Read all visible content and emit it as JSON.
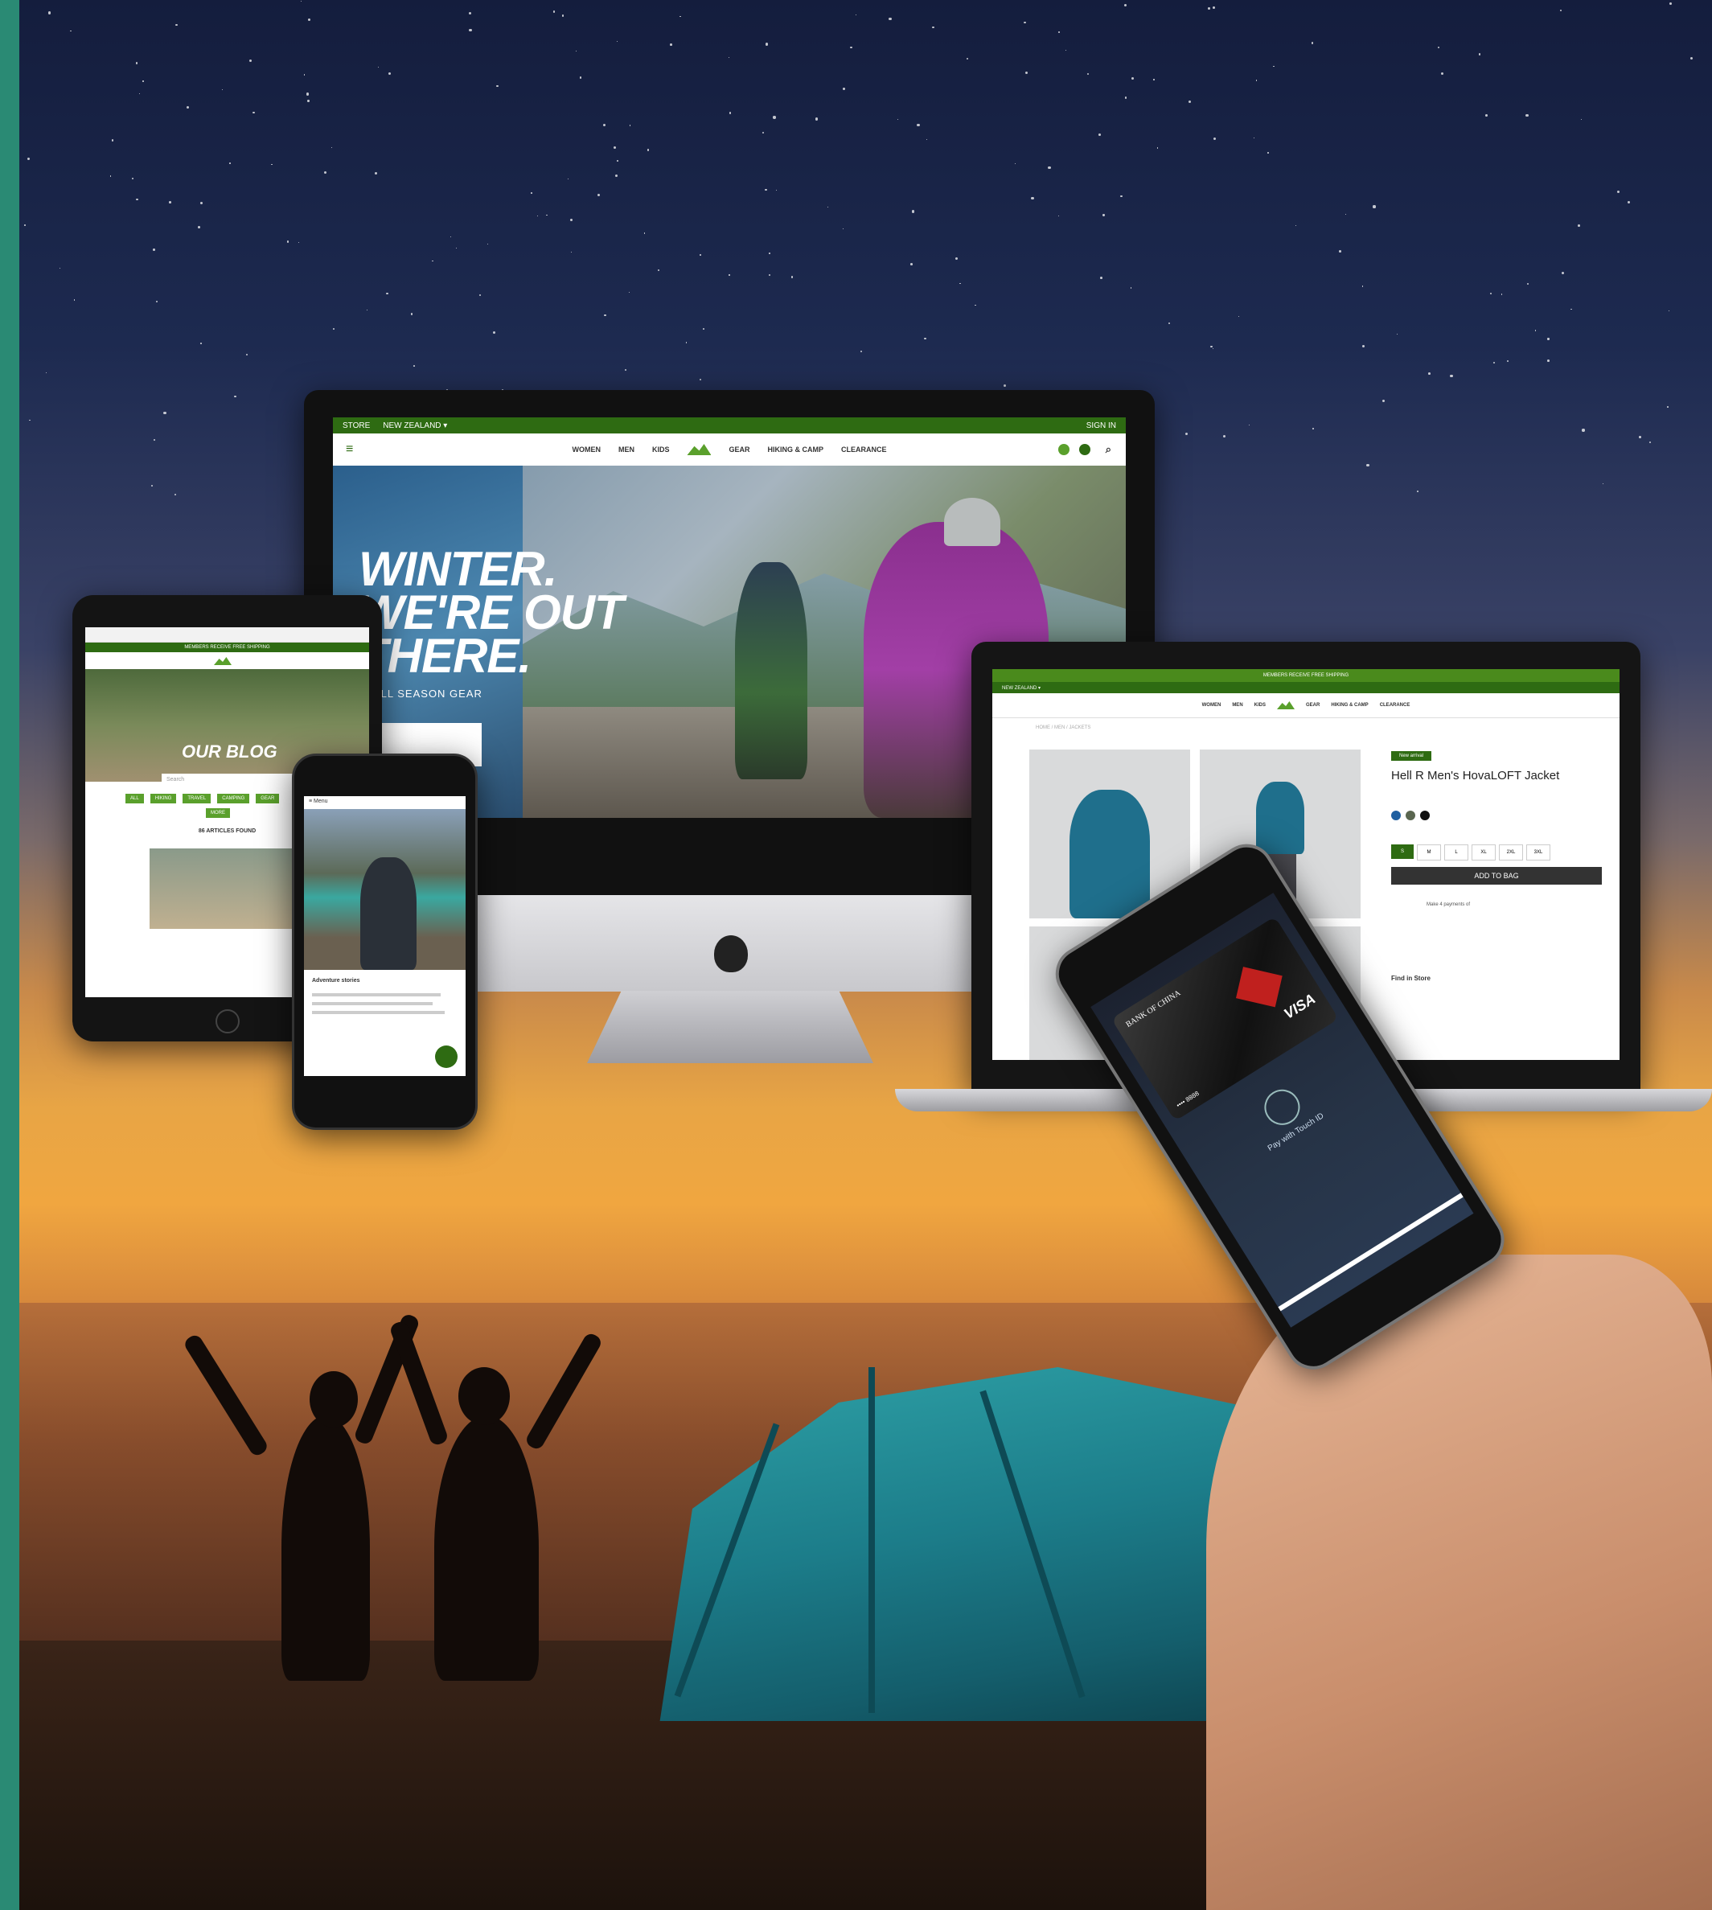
{
  "imac": {
    "top_bar": {
      "left": "STORE",
      "right_label": "NEW ZEALAND ▾",
      "account": "SIGN IN"
    },
    "nav_items": [
      "WOMEN",
      "MEN",
      "KIDS",
      "GEAR",
      "HIKING & CAMP",
      "CLEARANCE"
    ],
    "hero": {
      "title_line1": "WINTER.",
      "title_line2": "WE'RE OUT",
      "title_line3": "THERE.",
      "subtitle": "ALL SEASON GEAR"
    }
  },
  "tablet": {
    "promo_bar": "MEMBERS RECEIVE FREE SHIPPING",
    "blog_title": "OUR BLOG",
    "search_placeholder": "Search",
    "tags": [
      "ALL",
      "HIKING",
      "TRAVEL",
      "CAMPING",
      "GEAR"
    ],
    "tag_extra": "MORE",
    "articles_heading": "86 ARTICLES FOUND"
  },
  "phone": {
    "header": "≡ Menu",
    "article_title": "Adventure stories"
  },
  "laptop": {
    "promo_bar": "MEMBERS RECEIVE FREE SHIPPING",
    "top_bar": "NEW ZEALAND ▾",
    "nav_items": [
      "WOMEN",
      "MEN",
      "KIDS",
      "GEAR",
      "HIKING & CAMP",
      "CLEARANCE"
    ],
    "breadcrumb": "HOME / MEN / JACKETS",
    "badge": "New arrival",
    "product_title": "Hell R Men's HovaLOFT Jacket",
    "sizes": [
      "S",
      "M",
      "L",
      "XL",
      "2XL",
      "3XL"
    ],
    "add_button": "ADD TO BAG",
    "afterpay": "Make 4 payments of",
    "find_in_store": "Find in Store",
    "colors": [
      "#1f5fa0",
      "#5a6650",
      "#111111"
    ]
  },
  "payment": {
    "bank": "BANK OF CHINA",
    "network": "VISA",
    "card_number": "•••• 8888",
    "prompt": "Pay with Touch ID"
  }
}
